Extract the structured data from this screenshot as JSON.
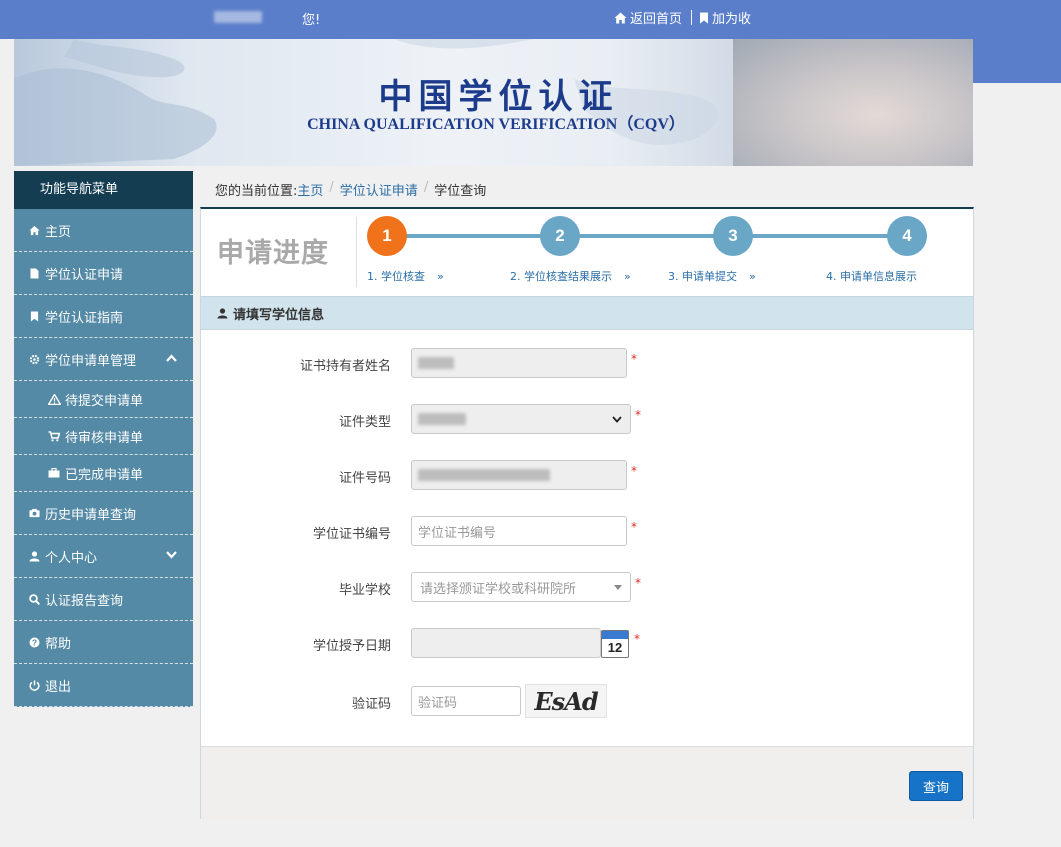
{
  "topbar": {
    "greeting": "您!",
    "home_link": "返回首页",
    "bookmark_link": "加为收"
  },
  "banner": {
    "title_cn": "中国学位认证",
    "title_en": "CHINA QUALIFICATION VERIFICATION（CQV）"
  },
  "sidebar": {
    "header": "功能导航菜单",
    "items": [
      {
        "label": "主页",
        "icon": "home-icon"
      },
      {
        "label": "学位认证申请",
        "icon": "file-icon"
      },
      {
        "label": "学位认证指南",
        "icon": "bookmark-icon"
      },
      {
        "label": "学位申请单管理",
        "icon": "gear-icon",
        "expanded": true
      },
      {
        "label": "历史申请单查询",
        "icon": "camera-icon"
      },
      {
        "label": "个人中心",
        "icon": "user-icon",
        "expanded": false
      },
      {
        "label": "认证报告查询",
        "icon": "search-icon"
      },
      {
        "label": "帮助",
        "icon": "help-icon"
      },
      {
        "label": "退出",
        "icon": "power-icon"
      }
    ],
    "subitems": [
      {
        "label": "待提交申请单",
        "icon": "warning-icon"
      },
      {
        "label": "待审核申请单",
        "icon": "cart-icon"
      },
      {
        "label": "已完成申请单",
        "icon": "briefcase-icon"
      }
    ]
  },
  "breadcrumb": {
    "prefix": "您的当前位置:",
    "home": "主页",
    "apply": "学位认证申请",
    "current": "学位查询"
  },
  "progress": {
    "title": "申请进度",
    "current_step": 1,
    "steps": [
      {
        "num": "1",
        "label": "1. 学位核查"
      },
      {
        "num": "2",
        "label": "2. 学位核查结果展示"
      },
      {
        "num": "3",
        "label": "3. 申请单提交"
      },
      {
        "num": "4",
        "label": "4. 申请单信息展示"
      }
    ],
    "arrow": "»"
  },
  "form": {
    "section_title": "请填写学位信息",
    "fields": {
      "holder_name_label": "证书持有者姓名",
      "id_type_label": "证件类型",
      "id_number_label": "证件号码",
      "cert_number_label": "学位证书编号",
      "cert_number_placeholder": "学位证书编号",
      "school_label": "毕业学校",
      "school_placeholder": "请选择颁证学校或科研院所",
      "date_label": "学位授予日期",
      "calendar_day": "12",
      "captcha_label": "验证码",
      "captcha_placeholder": "验证码",
      "captcha_text": "EsAd"
    },
    "required_mark": "*",
    "submit_label": "查询"
  },
  "colors": {
    "topbar": "#5a7ec9",
    "sidebar": "#548aa6",
    "sidebar_header": "#143d52",
    "step_active": "#f0731c",
    "step_inactive": "#6aa6c6",
    "button": "#1773c7"
  }
}
